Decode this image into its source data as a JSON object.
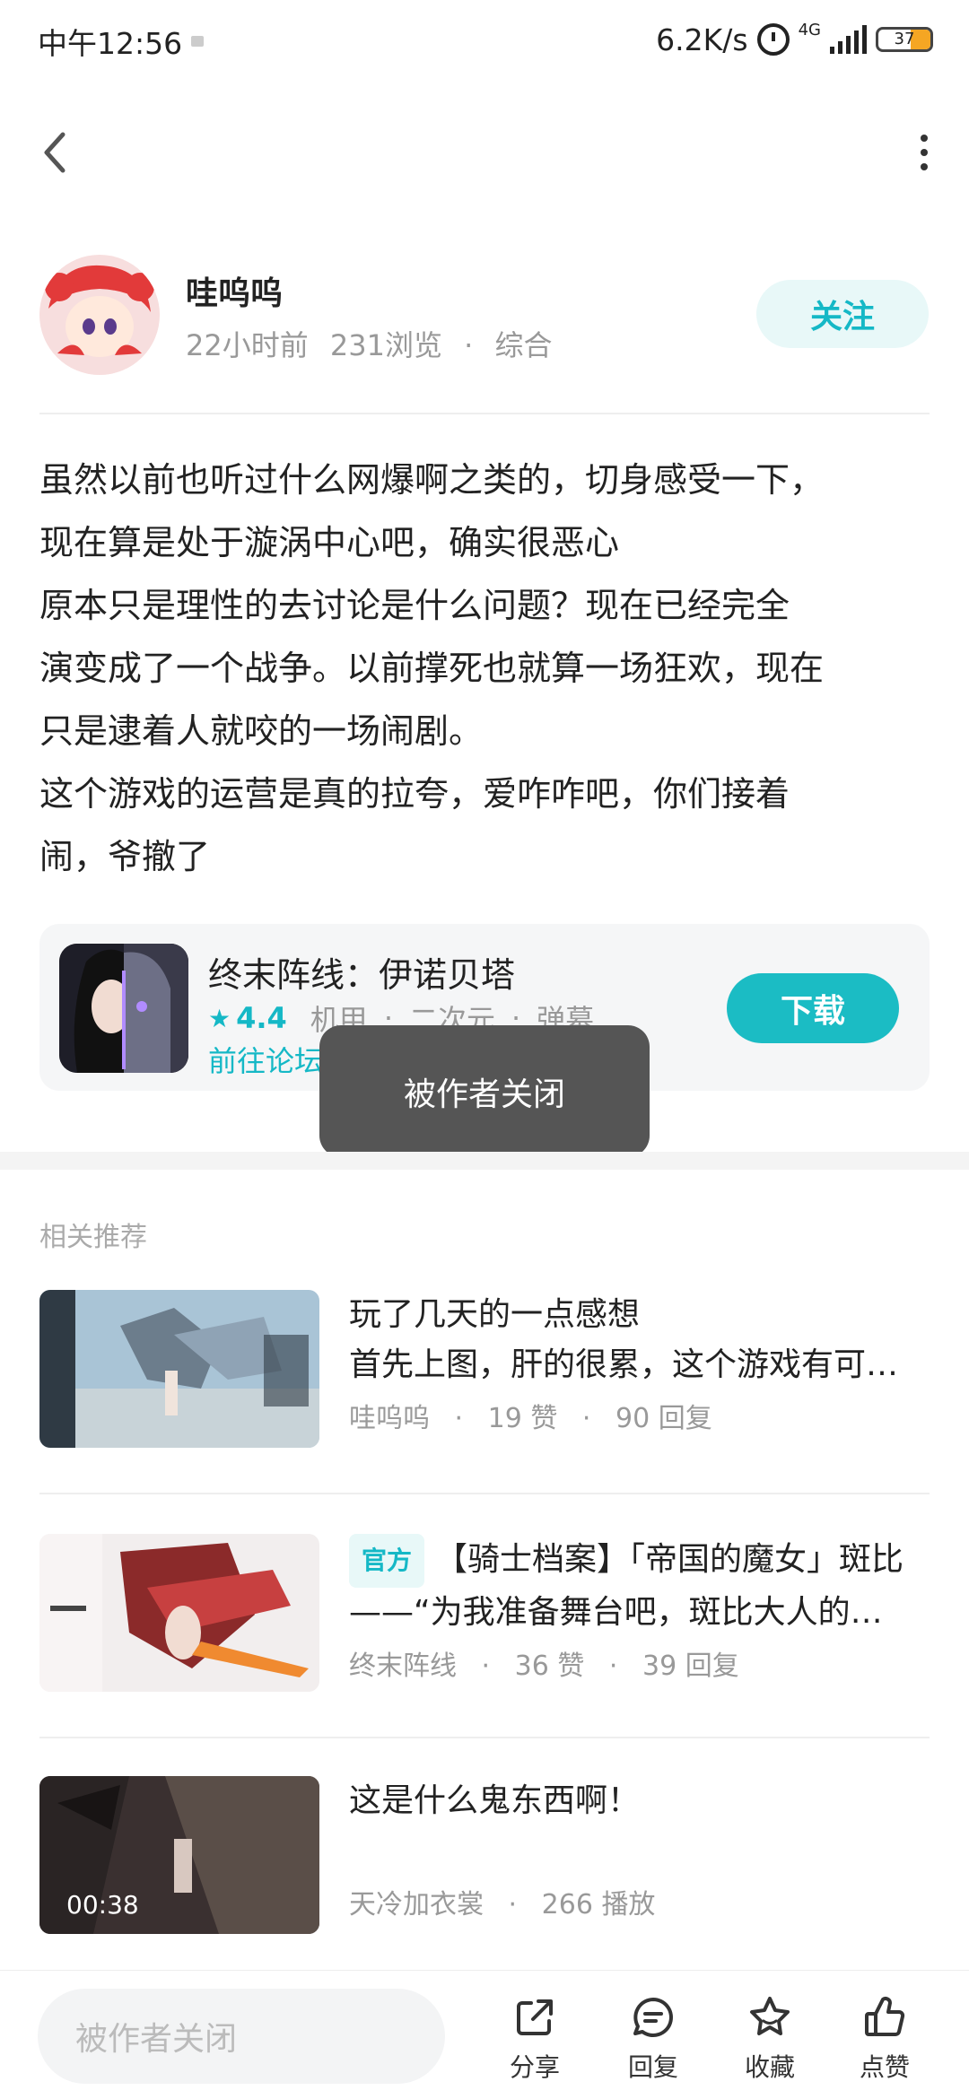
{
  "status_bar": {
    "time": "中午12:56",
    "speed": "6.2K/s",
    "network": "4G",
    "battery": "37"
  },
  "author": {
    "name": "哇呜呜",
    "time": "22小时前",
    "views": "231浏览",
    "category": "综合",
    "follow_label": "关注"
  },
  "post": {
    "lines": [
      "虽然以前也听过什么网爆啊之类的，切身感受一下，",
      "现在算是处于漩涡中心吧，确实很恶心",
      "原本只是理性的去讨论是什么问题？现在已经完全",
      "演变成了一个战争。以前撑死也就算一场狂欢，现在",
      "只是逮着人就咬的一场闹剧。",
      "这个游戏的运营是真的拉夸，爱咋咋吧，你们接着",
      "闹，爷撤了"
    ]
  },
  "game_card": {
    "title": "终末阵线：伊诺贝塔",
    "rating": "4.4",
    "tags": [
      "机甲",
      "二次元",
      "弹幕"
    ],
    "forum_link": "前往论坛",
    "download_label": "下载"
  },
  "toast": "被作者关闭",
  "recommendations": {
    "title": "相关推荐",
    "items": [
      {
        "line1": "玩了几天的一点感想",
        "line2": "首先上图，肝的很累，这个游戏有可…",
        "author": "哇呜呜",
        "likes": "19 赞",
        "stat": "90 回复"
      },
      {
        "badge": "官方",
        "line1": "【骑士档案】「帝国的魔女」斑比",
        "line2": "——“为我准备舞台吧，斑比大人的…",
        "author": "终末阵线",
        "likes": "36 赞",
        "stat": "39 回复"
      },
      {
        "line1": "这是什么鬼东西啊！",
        "author": "天冷加衣裳",
        "stat": "266 播放",
        "duration": "00:38"
      }
    ]
  },
  "bottom_bar": {
    "input_placeholder": "被作者关闭",
    "share": "分享",
    "reply": "回复",
    "favorite": "收藏",
    "like": "点赞"
  },
  "colors": {
    "accent": "#15b8c6",
    "download_button": "#1bbcc4",
    "toast_bg": "#555555"
  }
}
